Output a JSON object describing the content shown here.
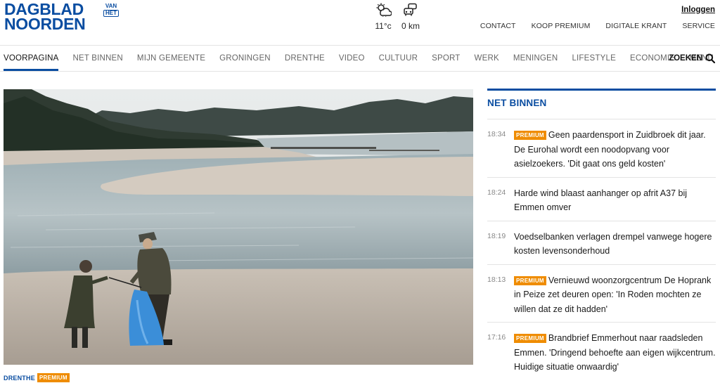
{
  "logo": {
    "line1": "DAGBLAD",
    "line2": "NOORDEN",
    "van": "VAN",
    "het": "HET"
  },
  "weather": {
    "temperature": "11°c",
    "traffic": "0 km",
    "weather_icon": "cloud-sun-rain-icon",
    "traffic_icon": "traffic-jam-icon"
  },
  "header": {
    "login": "Inloggen",
    "links": [
      "CONTACT",
      "KOOP PREMIUM",
      "DIGITALE KRANT",
      "SERVICE"
    ]
  },
  "nav": {
    "items": [
      "VOORPAGINA",
      "NET BINNEN",
      "MIJN GEMEENTE",
      "GRONINGEN",
      "DRENTHE",
      "VIDEO",
      "CULTUUR",
      "SPORT",
      "WERK",
      "MENINGEN",
      "LIFESTYLE",
      "ECONOMIE",
      "MENU"
    ],
    "active": "VOORPAGINA",
    "search_label": "ZOEKEN"
  },
  "hero": {
    "category": "DRENTHE",
    "badge": "PREMIUM"
  },
  "sidebar": {
    "title": "NET BINNEN",
    "items": [
      {
        "time": "18:34",
        "premium": "PREMIUM",
        "text": "Geen paardensport in Zuidbroek dit jaar. De Eurohal wordt een noodopvang voor asielzoekers. 'Dit gaat ons geld kosten'"
      },
      {
        "time": "18:24",
        "premium": "",
        "text": "Harde wind blaast aanhanger op afrit A37 bij Emmen omver"
      },
      {
        "time": "18:19",
        "premium": "",
        "text": "Voedselbanken verlagen drempel vanwege hogere kosten levensonderhoud"
      },
      {
        "time": "18:13",
        "premium": "PREMIUM",
        "text": "Vernieuwd woonzorgcentrum De Hoprank in Peize zet deuren open: 'In Roden mochten ze willen dat ze dit hadden'"
      },
      {
        "time": "17:16",
        "premium": "PREMIUM",
        "text": "Brandbrief Emmerhout naar raadsleden Emmen. 'Dringend behoefte aan eigen wijkcentrum. Huidige situatie onwaardig'"
      }
    ]
  },
  "colors": {
    "brand_blue": "#0a4da1",
    "premium_orange": "#ef8c00"
  }
}
